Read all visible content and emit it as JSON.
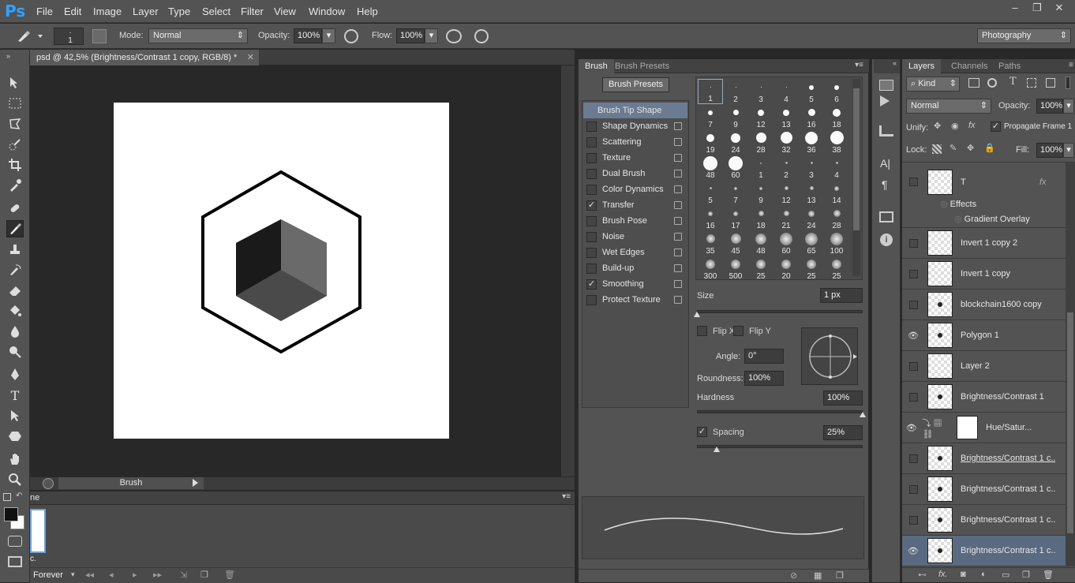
{
  "app": {
    "logo": "Ps"
  },
  "menu": [
    "File",
    "Edit",
    "Image",
    "Layer",
    "Type",
    "Select",
    "Filter",
    "View",
    "Window",
    "Help"
  ],
  "options": {
    "brush_size": "1",
    "mode_label": "Mode:",
    "mode_value": "Normal",
    "opacity_label": "Opacity:",
    "opacity_value": "100%",
    "flow_label": "Flow:",
    "flow_value": "100%",
    "workspace": "Photography"
  },
  "document": {
    "tab_title": "psd @ 42,5% (Brightness/Contrast 1 copy, RGB/8) *",
    "status_label": "Brush"
  },
  "timeline": {
    "tab": "ne",
    "frame_label": "c.",
    "loop": "Forever"
  },
  "brush_panel": {
    "tabs": [
      "Brush",
      "Brush Presets"
    ],
    "presets_button": "Brush Presets",
    "options": [
      {
        "label": "Brush Tip Shape",
        "header": true
      },
      {
        "label": "Shape Dynamics",
        "checked": false
      },
      {
        "label": "Scattering",
        "checked": false
      },
      {
        "label": "Texture",
        "checked": false
      },
      {
        "label": "Dual Brush",
        "checked": false
      },
      {
        "label": "Color Dynamics",
        "checked": false
      },
      {
        "label": "Transfer",
        "checked": true
      },
      {
        "label": "Brush Pose",
        "checked": false
      },
      {
        "label": "Noise",
        "checked": false
      },
      {
        "label": "Wet Edges",
        "checked": false
      },
      {
        "label": "Build-up",
        "checked": false
      },
      {
        "label": "Smoothing",
        "checked": true
      },
      {
        "label": "Protect Texture",
        "checked": false
      }
    ],
    "tip_sizes": [
      "1",
      "2",
      "3",
      "4",
      "5",
      "6",
      "7",
      "9",
      "12",
      "13",
      "16",
      "18",
      "19",
      "24",
      "28",
      "32",
      "36",
      "38",
      "48",
      "60",
      "1",
      "2",
      "3",
      "4",
      "5",
      "7",
      "9",
      "12",
      "13",
      "14",
      "16",
      "17",
      "18",
      "21",
      "24",
      "28",
      "35",
      "45",
      "48",
      "60",
      "65",
      "100",
      "300",
      "500",
      "25",
      "20",
      "25",
      "25"
    ],
    "size_label": "Size",
    "size_value": "1 px",
    "flip_x": "Flip X",
    "flip_y": "Flip Y",
    "angle_label": "Angle:",
    "angle_value": "0°",
    "roundness_label": "Roundness:",
    "roundness_value": "100%",
    "hardness_label": "Hardness",
    "hardness_value": "100%",
    "spacing_label": "Spacing",
    "spacing_value": "25%"
  },
  "layers_panel": {
    "tabs": [
      "Layers",
      "Channels",
      "Paths"
    ],
    "filter": "Kind",
    "blend": "Normal",
    "opacity_label": "Opacity:",
    "opacity_value": "100%",
    "unify_label": "Unify:",
    "propagate_label": "Propagate Frame 1",
    "lock_label": "Lock:",
    "fill_label": "Fill:",
    "fill_value": "100%",
    "effects_label": "Effects",
    "gradient_overlay_label": "Gradient Overlay",
    "layers": [
      {
        "name": "T",
        "visible": false
      },
      {
        "name": "Invert 1 copy 2",
        "visible": false
      },
      {
        "name": "Invert 1 copy",
        "visible": false
      },
      {
        "name": "blockchain1600 copy",
        "visible": false
      },
      {
        "name": "Polygon 1",
        "visible": true
      },
      {
        "name": "Layer 2",
        "visible": false
      },
      {
        "name": "Brightness/Contrast 1",
        "visible": false
      },
      {
        "name": "Hue/Satur...",
        "visible": true
      },
      {
        "name": "Brightness/Contrast 1 c...",
        "visible": false
      },
      {
        "name": "Brightness/Contrast 1 c...",
        "visible": false
      },
      {
        "name": "Brightness/Contrast 1 c...",
        "visible": false
      },
      {
        "name": "Brightness/Contrast 1 c...",
        "visible": true,
        "selected": true
      }
    ]
  }
}
